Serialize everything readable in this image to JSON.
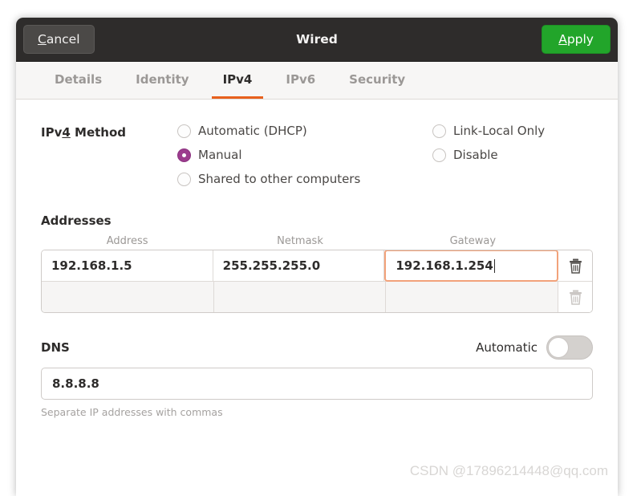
{
  "window": {
    "title": "Wired",
    "cancel_label": "Cancel",
    "cancel_mnemonic": "C",
    "apply_label": "Apply",
    "apply_mnemonic": "A",
    "accent_green": "#22a52a",
    "headerbar_bg": "#2e2c2b",
    "accent_orange": "#e8601c",
    "radio_selected_color": "#9c3c8e"
  },
  "tabs": [
    {
      "label": "Details",
      "active": false
    },
    {
      "label": "Identity",
      "active": false
    },
    {
      "label": "IPv4",
      "active": true
    },
    {
      "label": "IPv6",
      "active": false
    },
    {
      "label": "Security",
      "active": false
    }
  ],
  "method": {
    "label_before": "IPv",
    "label_mnemonic": "4",
    "label_after": " Method",
    "options_left": [
      {
        "label": "Automatic (DHCP)",
        "selected": false
      },
      {
        "label": "Manual",
        "selected": true
      },
      {
        "label": "Shared to other computers",
        "selected": false
      }
    ],
    "options_right": [
      {
        "label": "Link-Local Only",
        "selected": false
      },
      {
        "label": "Disable",
        "selected": false
      }
    ]
  },
  "addresses": {
    "title": "Addresses",
    "columns": [
      "Address",
      "Netmask",
      "Gateway"
    ],
    "rows": [
      {
        "address": "192.168.1.5",
        "netmask": "255.255.255.0",
        "gateway": "192.168.1.254",
        "gateway_focused": true,
        "empty": false,
        "delete_enabled": true
      },
      {
        "address": "",
        "netmask": "",
        "gateway": "",
        "gateway_focused": false,
        "empty": true,
        "delete_enabled": false
      }
    ],
    "delete_icon": "trash-icon"
  },
  "dns": {
    "title": "DNS",
    "automatic_label": "Automatic",
    "automatic_on": false,
    "value": "8.8.8.8",
    "placeholder": "",
    "hint": "Separate IP addresses with commas"
  },
  "watermark": {
    "text": "CSDN @17896214448@qq.com"
  }
}
